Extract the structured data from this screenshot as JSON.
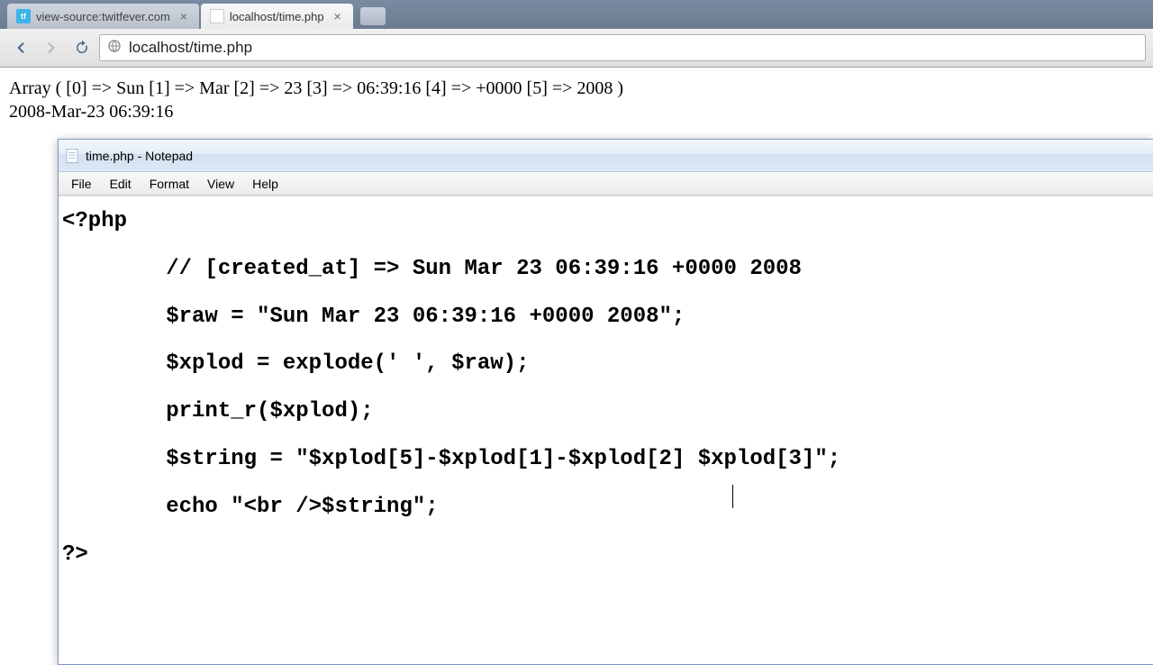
{
  "browser": {
    "tabs": [
      {
        "label": "view-source:twitfever.com",
        "favicon": "tf",
        "active": false
      },
      {
        "label": "localhost/time.php",
        "favicon": "blank",
        "active": true
      }
    ],
    "url": "localhost/time.php"
  },
  "page": {
    "line1": "Array ( [0] => Sun [1] => Mar [2] => 23 [3] => 06:39:16 [4] => +0000 [5] => 2008 )",
    "line2": "2008-Mar-23 06:39:16"
  },
  "notepad": {
    "title": "time.php - Notepad",
    "menu": {
      "file": "File",
      "edit": "Edit",
      "format": "Format",
      "view": "View",
      "help": "Help"
    },
    "code": "<?php\n        // [created_at] => Sun Mar 23 06:39:16 +0000 2008\n        $raw = \"Sun Mar 23 06:39:16 +0000 2008\";\n        $xplod = explode(' ', $raw);\n        print_r($xplod);\n        $string = \"$xplod[5]-$xplod[1]-$xplod[2] $xplod[3]\";\n        echo \"<br />$string\";\n?>"
  }
}
